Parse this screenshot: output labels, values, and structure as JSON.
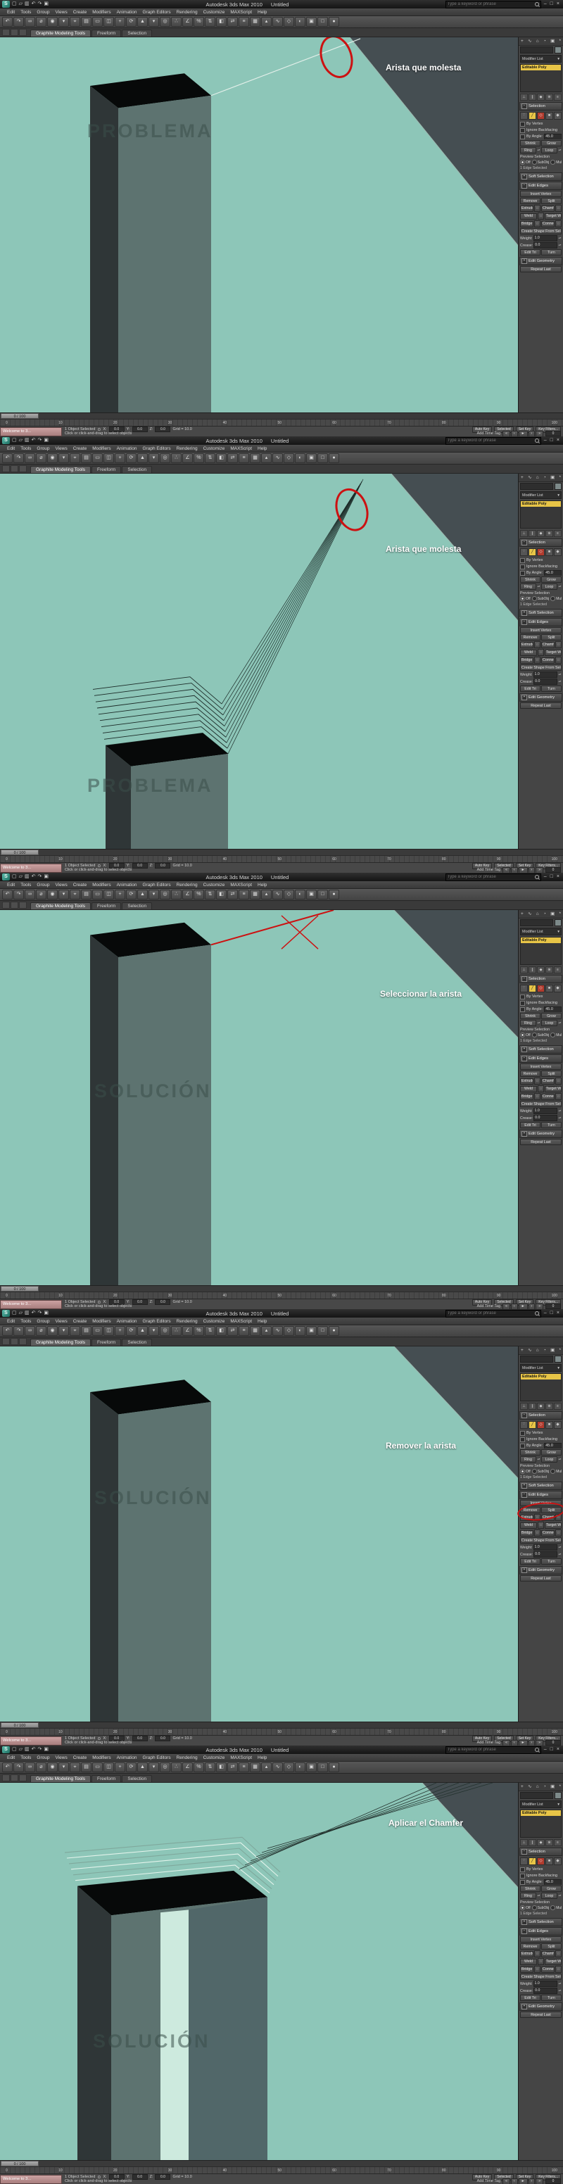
{
  "colors": {
    "viewport_teal": "#8dc6b8",
    "panel_dark": "#454e52",
    "column_face": "#5d7370",
    "column_side": "#2f3637",
    "top_face": "#070909",
    "annotation_red": "#cc1111",
    "highlight_yellow": "#e8c547"
  },
  "titlebar": {
    "app_title": "Autodesk 3ds Max 2010",
    "doc_title": "Untitled",
    "search_placeholder": "Type a keyword or phrase",
    "qat_icons": [
      {
        "name": "new-scene-icon",
        "glyph": "▢"
      },
      {
        "name": "open-file-icon",
        "glyph": "▱"
      },
      {
        "name": "save-file-icon",
        "glyph": "▥"
      },
      {
        "name": "undo-icon",
        "glyph": "↶"
      },
      {
        "name": "redo-icon",
        "glyph": "↷"
      },
      {
        "name": "project-folder-icon",
        "glyph": "▣"
      }
    ],
    "window_buttons": [
      {
        "name": "minimize-button",
        "glyph": "–"
      },
      {
        "name": "maximize-button",
        "glyph": "□"
      },
      {
        "name": "close-button",
        "glyph": "×"
      }
    ]
  },
  "menus": [
    "Edit",
    "Tools",
    "Group",
    "Views",
    "Create",
    "Modifiers",
    "Animation",
    "Graph Editors",
    "Rendering",
    "Customize",
    "MAXScript",
    "Help"
  ],
  "toolbar_icons": [
    {
      "name": "undo-icon",
      "glyph": "↶"
    },
    {
      "name": "redo-icon",
      "glyph": "↷"
    },
    {
      "name": "select-and-link-icon",
      "glyph": "∞"
    },
    {
      "name": "unlink-selection-icon",
      "glyph": "⌀"
    },
    {
      "name": "bind-to-space-warp-icon",
      "glyph": "◉"
    },
    {
      "name": "selection-filter-dropdown",
      "glyph": "▾"
    },
    {
      "name": "select-object-icon",
      "glyph": "⌖"
    },
    {
      "name": "select-by-name-icon",
      "glyph": "▤"
    },
    {
      "name": "rectangular-selection-region-icon",
      "glyph": "▭"
    },
    {
      "name": "window-crossing-toggle-icon",
      "glyph": "◫"
    },
    {
      "name": "select-and-move-icon",
      "glyph": "+"
    },
    {
      "name": "select-and-rotate-icon",
      "glyph": "⟳"
    },
    {
      "name": "select-and-scale-icon",
      "glyph": "▲"
    },
    {
      "name": "reference-coordinate-dropdown",
      "glyph": "▾"
    },
    {
      "name": "use-pivot-point-icon",
      "glyph": "◎"
    },
    {
      "name": "snap-toggle-icon",
      "glyph": "∴"
    },
    {
      "name": "angle-snap-icon",
      "glyph": "∠"
    },
    {
      "name": "percent-snap-icon",
      "glyph": "%"
    },
    {
      "name": "spinner-snap-icon",
      "glyph": "⇅"
    },
    {
      "name": "named-selection-sets-icon",
      "glyph": "◧"
    },
    {
      "name": "mirror-icon",
      "glyph": "⇄"
    },
    {
      "name": "align-icon",
      "glyph": "≡"
    },
    {
      "name": "layer-manager-icon",
      "glyph": "▦"
    },
    {
      "name": "graphite-ribbon-toggle-icon",
      "glyph": "▴"
    },
    {
      "name": "curve-editor-icon",
      "glyph": "∿"
    },
    {
      "name": "schematic-view-icon",
      "glyph": "◇"
    },
    {
      "name": "material-editor-icon",
      "glyph": "◐"
    },
    {
      "name": "render-setup-icon",
      "glyph": "▣"
    },
    {
      "name": "rendered-frame-window-icon",
      "glyph": "□"
    },
    {
      "name": "render-production-icon",
      "glyph": "●"
    }
  ],
  "ribbon_tabs": [
    "Graphite Modeling Tools",
    "Freeform",
    "Selection"
  ],
  "command_panel": {
    "tabs": [
      {
        "name": "create-tab",
        "glyph": "+"
      },
      {
        "name": "modify-tab",
        "glyph": "∿"
      },
      {
        "name": "hierarchy-tab",
        "glyph": "⌂"
      },
      {
        "name": "motion-tab",
        "glyph": "◔"
      },
      {
        "name": "display-tab",
        "glyph": "▣"
      },
      {
        "name": "utilities-tab",
        "glyph": "*"
      }
    ],
    "object_name": "",
    "modifier_list_label": "Modifier List",
    "stack_items": [
      "Editable Poly"
    ],
    "stack_tools": [
      {
        "name": "pin-stack-icon",
        "glyph": "⊥"
      },
      {
        "name": "show-end-result-icon",
        "glyph": "∥"
      },
      {
        "name": "make-unique-icon",
        "glyph": "◆"
      },
      {
        "name": "remove-modifier-icon",
        "glyph": "⊗"
      },
      {
        "name": "configure-modifier-sets-icon",
        "glyph": "≡"
      }
    ],
    "selection": {
      "title": "Selection",
      "subobject_icons": [
        {
          "name": "vertex-mode-icon",
          "glyph": "∵"
        },
        {
          "name": "edge-mode-icon",
          "glyph": "╱"
        },
        {
          "name": "border-mode-icon",
          "glyph": "◇"
        },
        {
          "name": "polygon-mode-icon",
          "glyph": "■"
        },
        {
          "name": "element-mode-icon",
          "glyph": "◆"
        }
      ],
      "by_vertex": "By Vertex",
      "ignore_backfacing": "Ignore Backfacing",
      "by_angle": "By Angle:",
      "by_angle_value": "45.0",
      "shrink": "Shrink",
      "grow": "Grow",
      "ring": "Ring",
      "loop": "Loop",
      "preview_label": "Preview Selection",
      "preview_options": [
        "Off",
        "SubObj",
        "Multi"
      ],
      "status": "1 Edge Selected"
    },
    "soft_selection_title": "Soft Selection",
    "edit_edges": {
      "title": "Edit Edges",
      "insert_vertex": "Insert Vertex",
      "remove": "Remove",
      "split": "Split",
      "extrude": "Extrude",
      "chamfer": "Chamfer",
      "weld": "Weld",
      "target_weld": "Target Weld",
      "bridge": "Bridge",
      "connect": "Connect",
      "create_shape": "Create Shape From Selection",
      "weight_label": "Weight:",
      "weight_value": "1.0",
      "crease_label": "Crease:",
      "crease_value": "0.0",
      "edit_tri": "Edit Tri",
      "turn": "Turn"
    },
    "edit_geometry_title": "Edit Geometry",
    "repeat_last": "Repeat Last"
  },
  "timeline": {
    "slider_label": "0 / 100",
    "ticks": [
      "0",
      "10",
      "20",
      "30",
      "40",
      "50",
      "60",
      "70",
      "80",
      "90",
      "100"
    ]
  },
  "statusbar": {
    "selected_text": "1 Object Selected",
    "prompt": "Click or click-and-drag to select objects",
    "grid_text": "Grid = 10.0",
    "coord_labels": [
      "X:",
      "Y:",
      "Z:"
    ],
    "coord_values": [
      "0.0",
      "0.0",
      "0.0"
    ],
    "auto_key": "Auto Key",
    "selected_filter": "Selected",
    "set_key": "Set Key",
    "key_filters": "Key Filters...",
    "add_time_tag": "Add Time Tag",
    "frame": "0",
    "transport": [
      {
        "name": "go-to-start-icon",
        "glyph": "«"
      },
      {
        "name": "previous-frame-icon",
        "glyph": "‹"
      },
      {
        "name": "play-icon",
        "glyph": "►"
      },
      {
        "name": "next-frame-icon",
        "glyph": "›"
      },
      {
        "name": "go-to-end-icon",
        "glyph": "»"
      }
    ]
  },
  "welcome_window": {
    "title": "Welcome to 3..."
  },
  "panels": [
    {
      "id": "problema-1",
      "watermark": "PROBLEMA",
      "annotation": "Arista que molesta",
      "variant": "edge-problem",
      "circle_remove": false
    },
    {
      "id": "problema-2",
      "watermark": "PROBLEMA",
      "annotation": "Arista que molesta",
      "variant": "chamfer-problem",
      "circle_remove": false
    },
    {
      "id": "solucion-1",
      "watermark": "SOLUCIÓN",
      "annotation": "Seleccionar la arista",
      "variant": "select-edge",
      "circle_remove": false
    },
    {
      "id": "solucion-2",
      "watermark": "SOLUCIÓN",
      "annotation": "Remover la arista",
      "variant": "edge-removed",
      "circle_remove": true
    },
    {
      "id": "solucion-3",
      "watermark": "SOLUCIÓN",
      "annotation": "Aplicar el Chamfer",
      "variant": "chamfer-applied",
      "circle_remove": false
    }
  ]
}
